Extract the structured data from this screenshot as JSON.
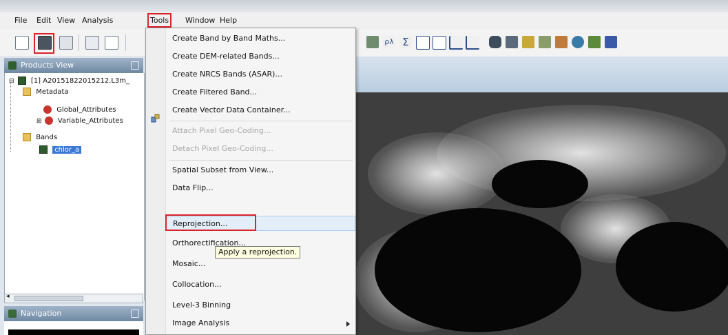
{
  "menubar": {
    "items": [
      "File",
      "Edit",
      "View",
      "Analysis",
      "Tools",
      "Window",
      "Help"
    ]
  },
  "toolbar_right_icons": [
    "pixel-info-icon",
    "spectrum-icon",
    "sum-icon",
    "histogram-icon",
    "scatter-icon",
    "profile-icon",
    "time-series-icon",
    "database-icon",
    "table-icon",
    "stars-icon",
    "gear-cluster-icon",
    "layers-icon",
    "user-icon",
    "globe-icon",
    "chart-icon"
  ],
  "products_view": {
    "title": "Products View",
    "tree": {
      "product": "[1] A20151822015212.L3m_",
      "metadata": "Metadata",
      "global_attributes": "Global_Attributes",
      "variable_attributes": "Variable_Attributes",
      "bands": "Bands",
      "band_selected": "chlor_a"
    }
  },
  "navigation": {
    "title": "Navigation"
  },
  "tools_menu": {
    "items": [
      {
        "label": "Create Band by Band Maths...",
        "enabled": true
      },
      {
        "label": "Create DEM-related Bands...",
        "enabled": true
      },
      {
        "label": "Create NRCS Bands (ASAR)...",
        "enabled": true
      },
      {
        "label": "Create Filtered Band...",
        "enabled": true
      },
      {
        "label": "Create Vector Data Container...",
        "enabled": true
      },
      {
        "label": "Attach Pixel Geo-Coding...",
        "enabled": false
      },
      {
        "label": "Detach Pixel Geo-Coding...",
        "enabled": false
      },
      {
        "label": "Spatial Subset from View...",
        "enabled": true
      },
      {
        "label": "Data Flip...",
        "enabled": true
      },
      {
        "label": "Reprojection...",
        "enabled": true
      },
      {
        "label": "Orthorectification...",
        "enabled": true
      },
      {
        "label": "Mosaic...",
        "enabled": true
      },
      {
        "label": "Collocation...",
        "enabled": true
      },
      {
        "label": "Level-3 Binning",
        "enabled": true
      },
      {
        "label": "Image Analysis",
        "enabled": true
      }
    ]
  },
  "tooltip": "Apply a reprojection.",
  "colors": {
    "highlight_red": "#d8232a",
    "menu_hover": "#e3eef9",
    "selection_blue": "#3a78d6"
  }
}
